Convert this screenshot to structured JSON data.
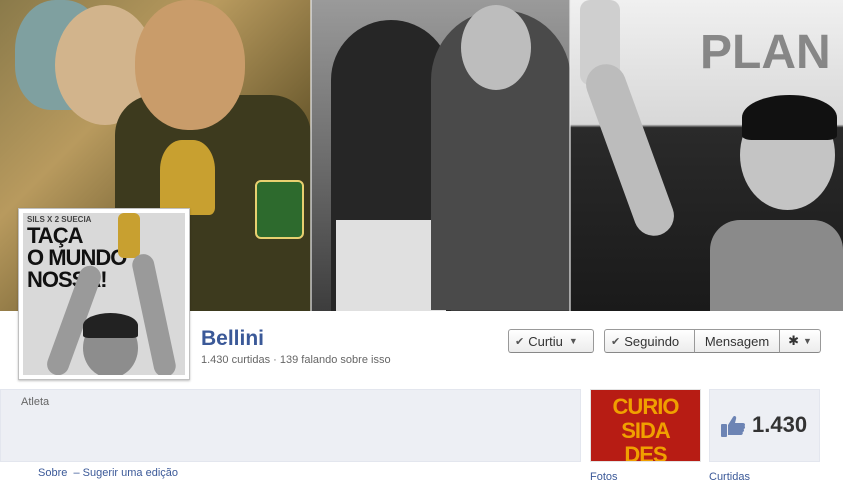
{
  "cover": {
    "panel3_text": "PLAN"
  },
  "profile_picture": {
    "top_line": "SILS X 2 SUECIA",
    "line1": "TAÇA",
    "line2": "O MUNDO",
    "line3": "NOSSA!"
  },
  "page": {
    "name": "Bellini",
    "stats": "1.430 curtidas · 139 falando sobre isso",
    "category": "Atleta"
  },
  "actions": {
    "liked_label": "Curtiu",
    "following_label": "Seguindo",
    "message_label": "Mensagem",
    "gear_icon": "gear-icon",
    "checkmark_icon": "check-icon",
    "caret_icon": "caret-down-icon"
  },
  "about_links": "Sobre  ‒ Sugerir uma edição",
  "apps": {
    "photos_thumb_text": [
      "CURIO",
      "SIDA",
      "DES"
    ],
    "photos_label": "Fotos",
    "likes_count": "1.430",
    "likes_label": "Curtidas"
  },
  "colors": {
    "link": "#3b5998",
    "thumb_red": "#b71c14",
    "thumb_text": "#f0a000",
    "info_bg": "#edeff4"
  }
}
